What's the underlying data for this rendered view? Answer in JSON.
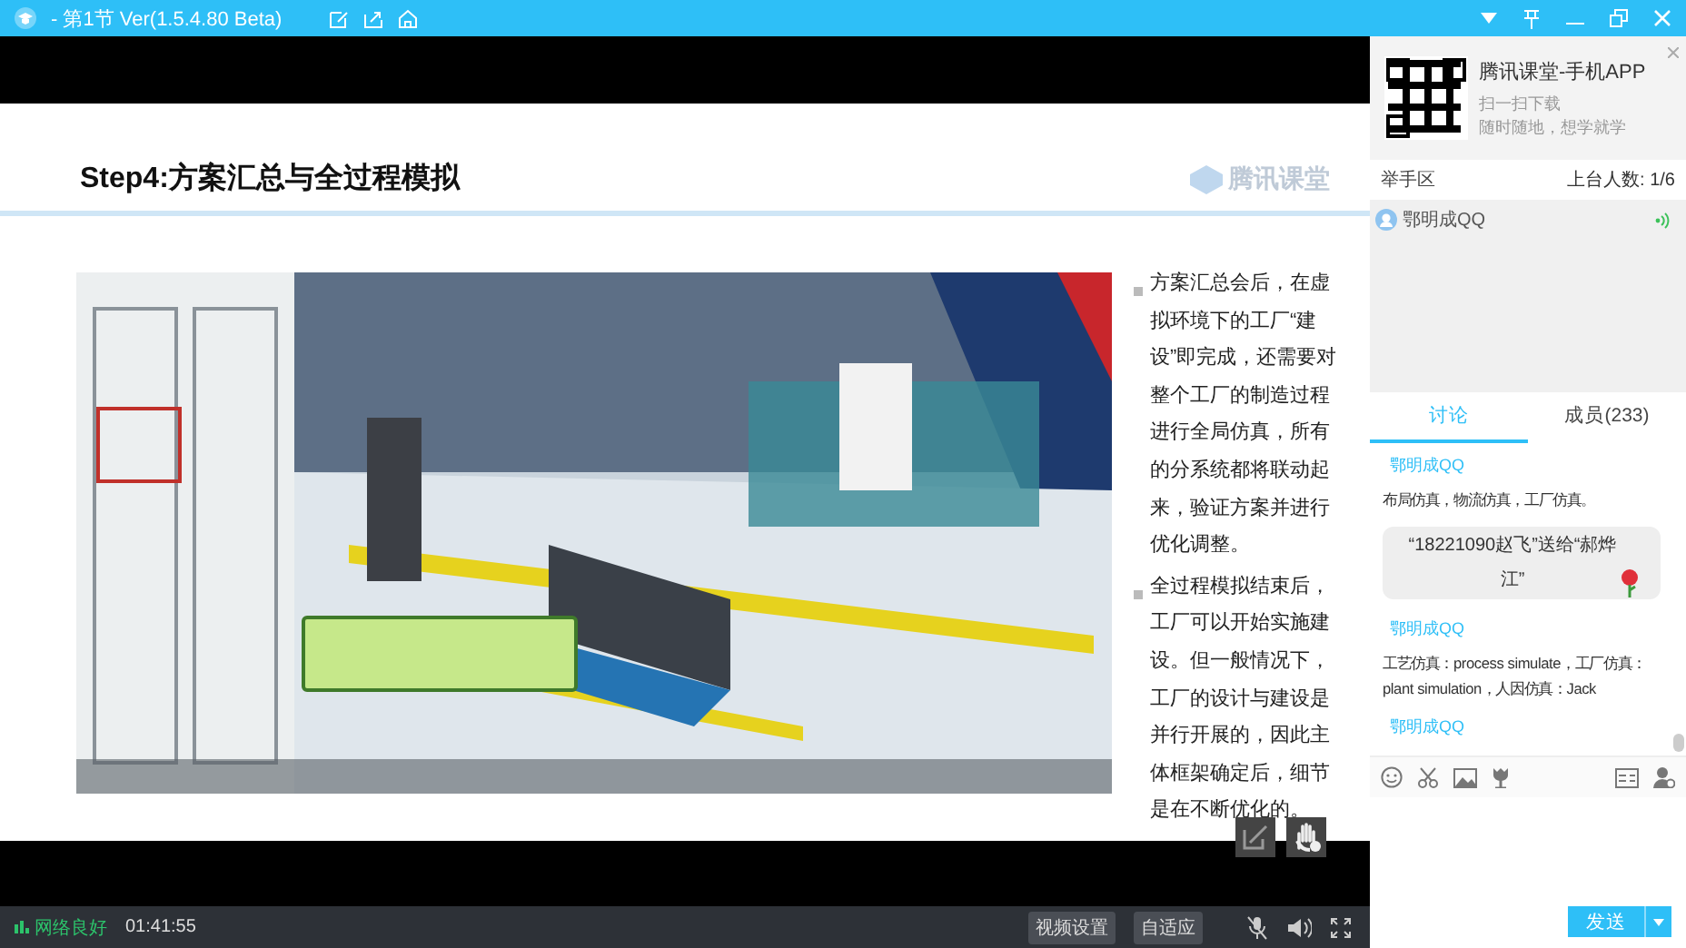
{
  "title_bar": {
    "title": "- 第1节 Ver(1.5.4.80 Beta)"
  },
  "slide": {
    "title": "Step4:方案汇总与全过程模拟",
    "logo": "腾讯课堂",
    "bullets": [
      "方案汇总会后，在虚拟环境下的工厂“建设”即完成，还需要对整个工厂的制造过程进行全局仿真，所有的分系统都将联动起来，验证方案并进行优化调整。",
      "全过程模拟结束后，工厂可以开始实施建设。但一般情况下，工厂的设计与建设是并行开展的，因此主体框架确定后，细节是在不断优化的。"
    ]
  },
  "status_bar": {
    "network": "网络良好",
    "time": "01:41:55",
    "buttons": [
      "视频设置",
      "自适应"
    ]
  },
  "promo": {
    "title": "腾讯课堂-手机APP",
    "lines": [
      "扫一扫下载",
      "随时随地，想学就学"
    ]
  },
  "hand_raise": {
    "title": "举手区",
    "count": "上台人数: 1/6",
    "members": [
      {
        "name": "鄂明成QQ"
      }
    ]
  },
  "tabs": [
    {
      "label": "讨论",
      "selected": true
    },
    {
      "label": "成员(233)",
      "selected": false
    }
  ],
  "chat": [
    {
      "kind": "message",
      "name": "鄂明成QQ",
      "text": "布局仿真，物流仿真，工厂仿真。"
    },
    {
      "kind": "gift",
      "text": "“18221090赵飞”送给“郝烨江”"
    },
    {
      "kind": "message",
      "name": "鄂明成QQ",
      "text": "工艺仿真：process simulate，工厂仿真：plant simulation，人因仿真：Jack"
    },
    {
      "kind": "message",
      "name": "鄂明成QQ"
    }
  ],
  "send_button": "发送"
}
